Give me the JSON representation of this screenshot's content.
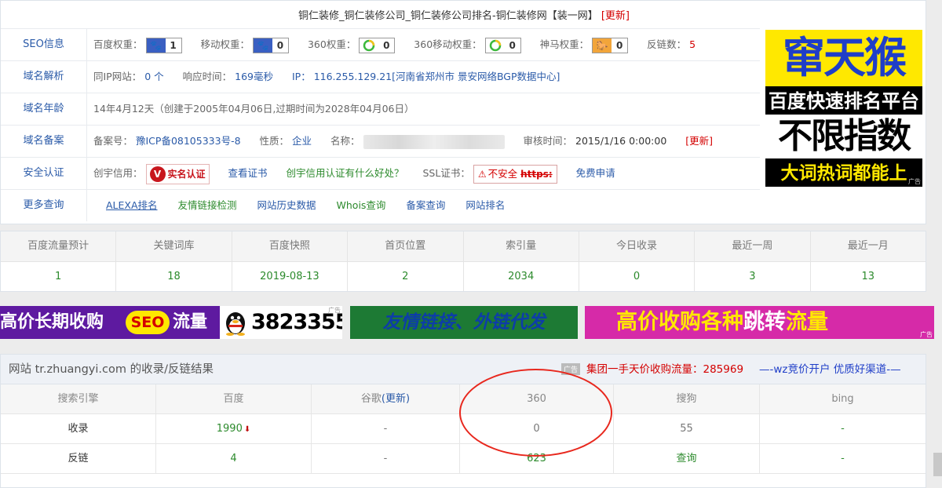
{
  "title": {
    "main": "铜仁装修_铜仁装修公司_铜仁装修公司排名-铜仁装修网【装一网】",
    "update": "[更新]"
  },
  "rows": {
    "seo": {
      "label": "SEO信息",
      "baidu_label": "百度权重：",
      "baidu_value": "1",
      "mobile_label": "移动权重：",
      "mobile_value": "0",
      "s360_label": "360权重：",
      "s360_value": "0",
      "m360_label": "360移动权重：",
      "m360_value": "0",
      "shenma_label": "神马权重：",
      "shenma_value": "0",
      "backlinks_label": "反链数：",
      "backlinks_value": "5"
    },
    "dns": {
      "label": "域名解析",
      "same_ip_label": "同IP网站：",
      "same_ip_value": "0 个",
      "resp_label": "响应时间：",
      "resp_value": "169毫秒",
      "ip_label": "IP：",
      "ip_value": "116.255.129.21[河南省郑州市 景安网络BGP数据中心]"
    },
    "age": {
      "label": "域名年龄",
      "value": "14年4月12天（创建于2005年04月06日,过期时间为2028年04月06日）"
    },
    "icp": {
      "label": "域名备案",
      "num_label": "备案号：",
      "num_value": "豫ICP备08105333号-8",
      "nature_label": "性质：",
      "nature_value": "企业",
      "name_label": "名称：",
      "audit_label": "审核时间：",
      "audit_value": "2015/1/16 0:00:00",
      "update": "[更新]"
    },
    "security": {
      "label": "安全认证",
      "cx_label": "创宇信用：",
      "cx_badge": "实名认证",
      "view_cert": "查看证书",
      "cx_benefit": "创宇信用认证有什么好处？",
      "ssl_label": "SSL证书：",
      "ssl_status": "不安全",
      "ssl_https": "https:",
      "apply": "免费申请"
    },
    "more": {
      "label": "更多查询",
      "links": [
        "ALEXA排名",
        "友情链接检测",
        "网站历史数据",
        "Whois查询",
        "备案查询",
        "网站排名"
      ]
    }
  },
  "side_ad": {
    "line1": "窜天猴",
    "line2": "百度快速排名平台",
    "line3": "不限指数",
    "line4": "大词热词都能上",
    "tag": "广告"
  },
  "stats": {
    "headers": [
      "百度流量预计",
      "关键词库",
      "百度快照",
      "首页位置",
      "索引量",
      "今日收录",
      "最近一周",
      "最近一月"
    ],
    "values": [
      "1",
      "18",
      "2019-08-13",
      "2",
      "2034",
      "0",
      "3",
      "13"
    ]
  },
  "banners": {
    "b1_part1": "高价长期收购",
    "b1_seo": "SEO",
    "b1_part2": "流量",
    "b2_number": "3823355",
    "b2_tag": "广告",
    "b3_text": "友情链接、外链代发",
    "b4_part1": "高价收购各种",
    "b4_em": "跳转",
    "b4_part2": "流量",
    "b4_tag": "广告"
  },
  "results": {
    "title": "网站 tr.zhuangyi.com 的收录/反链结果",
    "ad_tag": "广告",
    "promo": "集团一手天价收购流量：285969",
    "link": "—-wz竞价开户 优质好渠道-—",
    "headers": [
      "搜索引擎",
      "百度",
      "谷歌",
      "360",
      "搜狗",
      "bing"
    ],
    "google_update": "(更新)",
    "rows": [
      [
        "收录",
        "1990",
        "-",
        "0",
        "55",
        "-"
      ],
      [
        "反链",
        "4",
        "-",
        "623",
        "查询",
        "-"
      ]
    ]
  },
  "colors": {
    "link_blue": "#2a5aa8",
    "value_green": "#2c8a2c",
    "alert_red": "#d40000",
    "annotation_circle": "#e8281e"
  }
}
